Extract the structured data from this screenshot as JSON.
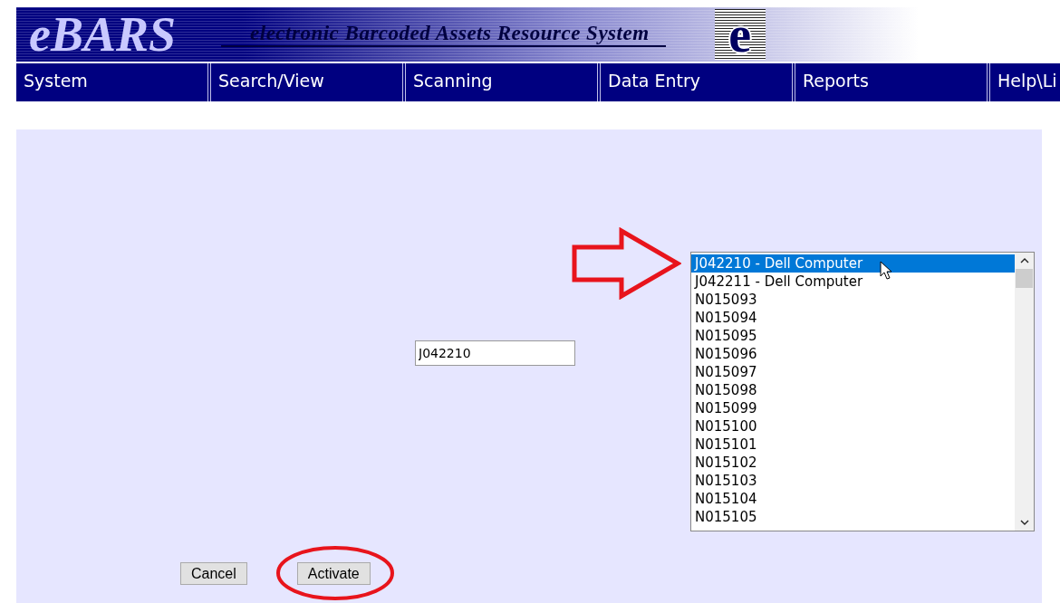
{
  "header": {
    "title": "eBARS",
    "subtitle": "electronic Barcoded Assets Resource System",
    "logo_letter": "e"
  },
  "menu": [
    {
      "label": "System"
    },
    {
      "label": "Search/View"
    },
    {
      "label": "Scanning"
    },
    {
      "label": "Data Entry"
    },
    {
      "label": "Reports"
    },
    {
      "label": "Help\\Li"
    }
  ],
  "asset_field": {
    "value": "J042210"
  },
  "asset_list": [
    {
      "label": "J042210 - Dell Computer",
      "selected": true
    },
    {
      "label": "J042211 - Dell Computer",
      "selected": false
    },
    {
      "label": "N015093",
      "selected": false
    },
    {
      "label": "N015094",
      "selected": false
    },
    {
      "label": "N015095",
      "selected": false
    },
    {
      "label": "N015096",
      "selected": false
    },
    {
      "label": "N015097",
      "selected": false
    },
    {
      "label": "N015098",
      "selected": false
    },
    {
      "label": "N015099",
      "selected": false
    },
    {
      "label": "N015100",
      "selected": false
    },
    {
      "label": "N015101",
      "selected": false
    },
    {
      "label": "N015102",
      "selected": false
    },
    {
      "label": "N015103",
      "selected": false
    },
    {
      "label": "N015104",
      "selected": false
    },
    {
      "label": "N015105",
      "selected": false
    }
  ],
  "buttons": [
    {
      "label": "Cancel",
      "highlighted": false
    },
    {
      "label": "Activate",
      "highlighted": true
    }
  ]
}
